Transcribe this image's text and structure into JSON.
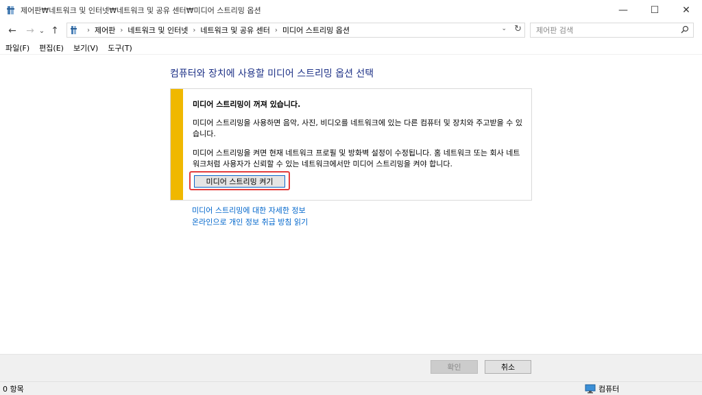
{
  "window": {
    "title": "제어판₩네트워크 및 인터넷₩네트워크 및 공유 센터₩미디어 스트리밍 옵션",
    "minimize_glyph": "—",
    "maximize_glyph": "☐",
    "close_glyph": "✕"
  },
  "nav": {
    "back_icon": "←",
    "forward_icon": "→",
    "recent_icon": "⌄",
    "up_icon": "↑",
    "breadcrumb": [
      "제어판",
      "네트워크 및 인터넷",
      "네트워크 및 공유 센터",
      "미디어 스트리밍 옵션"
    ],
    "separator": "›",
    "search_placeholder": "제어판 검색"
  },
  "menu": {
    "items": [
      "파일(F)",
      "편집(E)",
      "보기(V)",
      "도구(T)"
    ]
  },
  "main": {
    "heading": "컴퓨터와 장치에 사용할 미디어 스트리밍 옵션 선택",
    "notice_title": "미디어 스트리밍이 꺼져 있습니다.",
    "notice_p1": "미디어 스트리밍을 사용하면 음악, 사진, 비디오를 네트워크에 있는 다른 컴퓨터 및 장치와 주고받을 수 있습니다.",
    "notice_p2": "미디어 스트리밍을 켜면 현재 네트워크 프로필 및 방화벽 설정이 수정됩니다. 홈 네트워크 또는 회사 네트워크처럼 사용자가 신뢰할 수 있는 네트워크에서만 미디어 스트리밍을 켜야 합니다.",
    "turn_on_button": "미디어 스트리밍 켜기",
    "link_more_info": "미디어 스트리밍에 대한 자세한 정보",
    "link_privacy": "온라인으로 개인 정보 취급 방침 읽기"
  },
  "footer": {
    "ok_button": "확인",
    "cancel_button": "취소"
  },
  "status": {
    "item_count": "0 항목",
    "location": "컴퓨터"
  },
  "colors": {
    "heading": "#1e3287",
    "link": "#0066cc",
    "notice_bar": "#f0b800",
    "highlight": "#e23b3b"
  }
}
